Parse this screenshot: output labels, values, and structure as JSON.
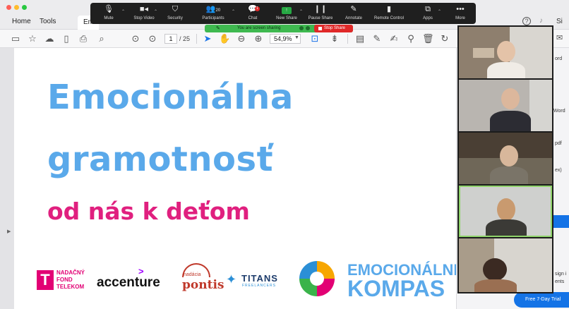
{
  "window": {
    "tabs": [
      "Home",
      "Tools",
      "Emoc"
    ],
    "sign_in": "Si"
  },
  "pdf_toolbar": {
    "page_current": "1",
    "page_total": "/ 25",
    "zoom": "54,9%"
  },
  "slide": {
    "title_line1": "Emocionálna",
    "title_line2": "gramotnosť",
    "subtitle": "od nás k deťom",
    "colors": {
      "title": "#5aa9ea",
      "subtitle": "#e0207f"
    },
    "sponsors": {
      "telekom_mark": "T",
      "telekom_text": "NADAČNÝ\nFOND\nTELEKOM",
      "accenture": "accenture",
      "accenture_mark": ">",
      "pontis_small": "nadácia",
      "pontis": "pontis",
      "titans": "TITANS",
      "titans_sub": "FREELANCERS",
      "kompas_line1": "EMOCIONÁLNI",
      "kompas_line2": "KOMPAS"
    }
  },
  "right_panel": {
    "texts": [
      "ord",
      "Word",
      "pdf",
      "ex)",
      "sign i",
      "ents"
    ],
    "trial_button": "Free 7-Day Trial"
  },
  "zoom_bar": {
    "items": [
      {
        "label": "Mute",
        "icon": "microphone-icon"
      },
      {
        "label": "Stop Video",
        "icon": "camera-icon"
      },
      {
        "label": "Security",
        "icon": "shield-icon"
      },
      {
        "label": "Participants",
        "icon": "participants-icon",
        "count": "20"
      },
      {
        "label": "Chat",
        "icon": "chat-icon",
        "badge": "1"
      },
      {
        "label": "New Share",
        "icon": "share-icon"
      },
      {
        "label": "Pause Share",
        "icon": "pause-icon"
      },
      {
        "label": "Annotate",
        "icon": "pen-icon"
      },
      {
        "label": "Remote Control",
        "icon": "mouse-icon"
      },
      {
        "label": "Apps",
        "icon": "apps-icon"
      },
      {
        "label": "More",
        "icon": "more-icon"
      }
    ],
    "sharing_text": "You are screen sharing",
    "stop_share": "Stop Share",
    "colors": {
      "sharing": "#3fb950",
      "stop": "#e02828"
    }
  }
}
